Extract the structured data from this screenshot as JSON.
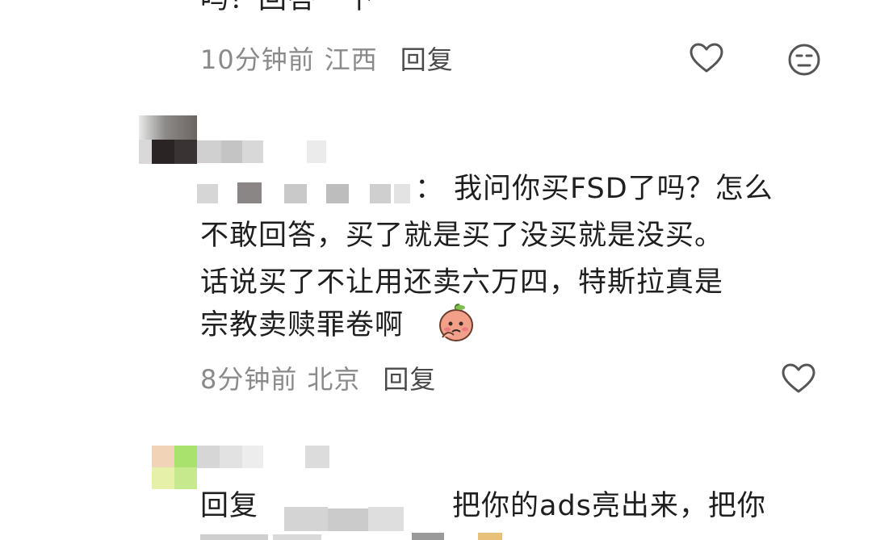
{
  "comments": [
    {
      "text_lines": [
        "吗？回答一下"
      ],
      "time": "10分钟前",
      "location": "江西",
      "reply_label": "回复",
      "icons": [
        "heart-outline-icon",
        "meh-face-icon"
      ]
    },
    {
      "author_suffix": "：",
      "text_lines": [
        "我问你买FSD了吗？怎么",
        "不敢回答，买了就是买了没买就是没买。",
        "话说买了不让用还卖六万四，特斯拉真是",
        "宗教卖赎罪卷啊"
      ],
      "emoji": "peach-emoji-icon",
      "time": "8分钟前",
      "location": "北京",
      "reply_label": "回复",
      "icons": [
        "heart-outline-icon"
      ]
    },
    {
      "reply_prefix": "回复",
      "text_lines": [
        "把你的ads亮出来，把你"
      ],
      "emoji": "emoji-partial-icon"
    }
  ],
  "colors": {
    "meta_gray": "#8a8a8a",
    "text_dark": "#1f1f1f",
    "icon_gray": "#555555"
  }
}
